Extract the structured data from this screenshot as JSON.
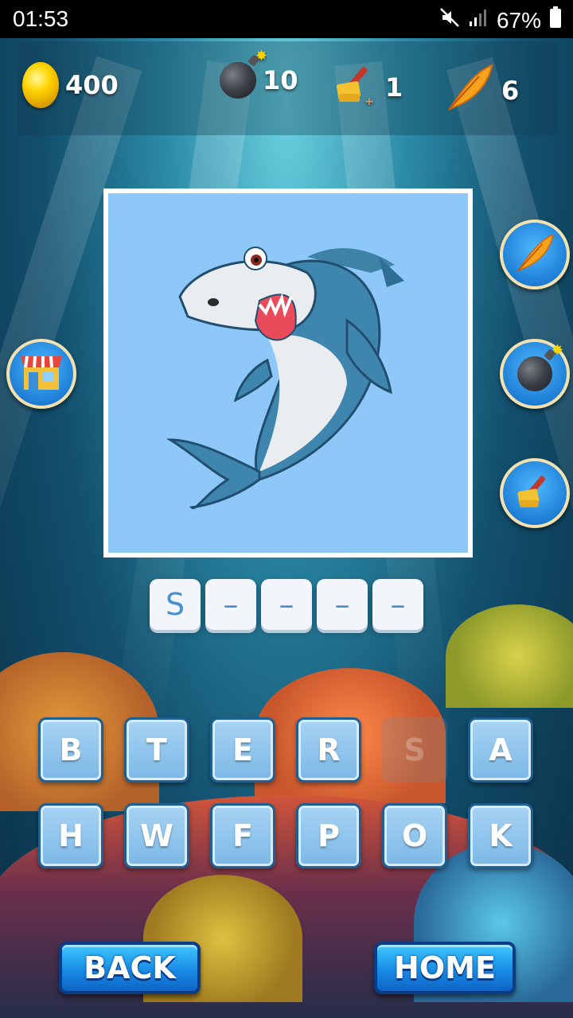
{
  "status_bar": {
    "time": "01:53",
    "battery": "67%"
  },
  "stats": {
    "coins": "400",
    "bombs": "10",
    "brush": "1",
    "feather": "6"
  },
  "icons": {
    "coins": "coin-icon",
    "bombs": "bomb-icon",
    "brush": "paint-brush-icon",
    "feather": "feather-icon",
    "shop": "shop-icon"
  },
  "puzzle": {
    "image_subject": "shark",
    "answer_slots": [
      "S",
      "–",
      "–",
      "–",
      "–"
    ]
  },
  "keyboard": {
    "row1": [
      "B",
      "T",
      "E",
      "R",
      "S",
      "A"
    ],
    "row2": [
      "H",
      "W",
      "F",
      "P",
      "O",
      "K"
    ],
    "used_letters": [
      "S"
    ]
  },
  "buttons": {
    "back": "BACK",
    "home": "HOME"
  },
  "colors": {
    "photo_bg": "#8ec8f8",
    "key_fill": "#7bb8e6",
    "nav_button": "#1a8ce6"
  }
}
